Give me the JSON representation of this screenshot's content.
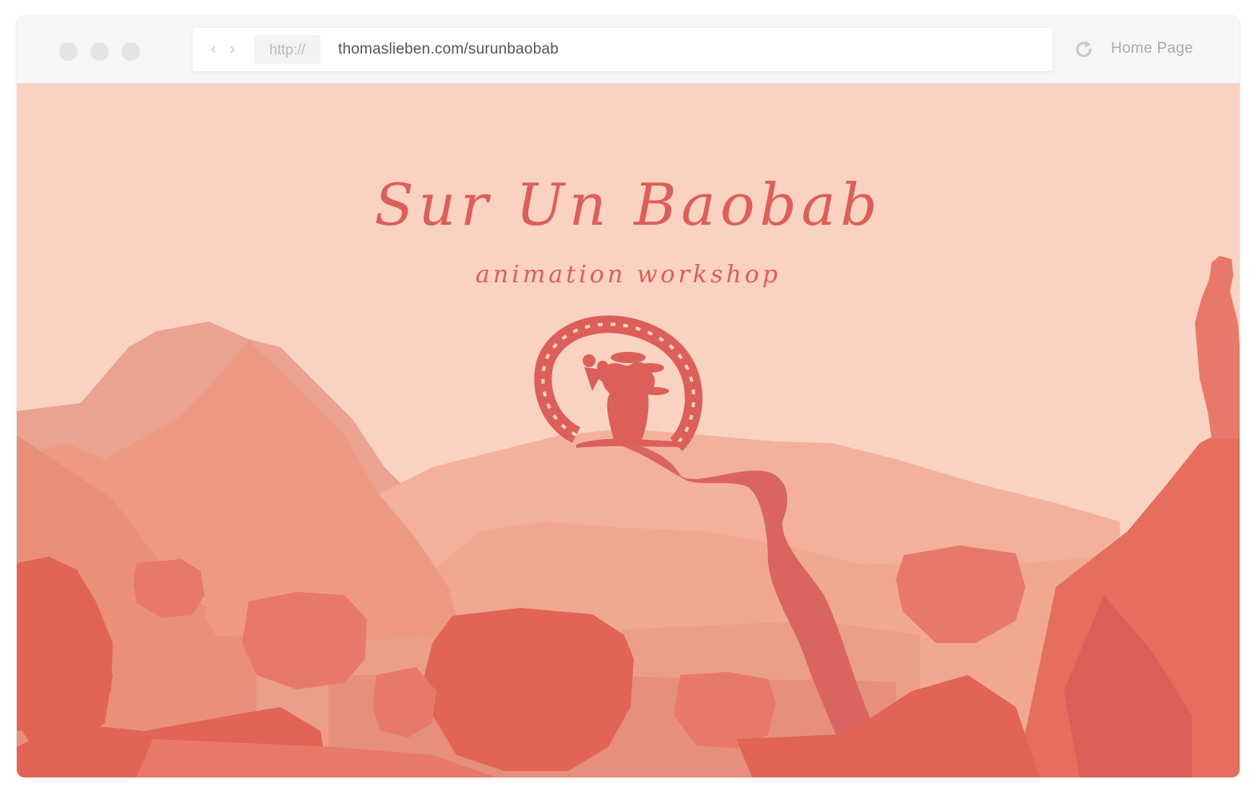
{
  "browser": {
    "protocol": "http://",
    "url": "thomaslieben.com/surunbaobab",
    "home_label": "Home Page",
    "icons": [
      "window-close-dot",
      "window-minimize-dot",
      "window-maximize-dot",
      "back-arrow-icon",
      "forward-arrow-icon",
      "reload-icon"
    ]
  },
  "page": {
    "title": "Sur Un Baobab",
    "subtitle": "animation workshop",
    "logo": "baobab-tree-logo",
    "colors": {
      "sky": "#fad2c2",
      "accent": "#dc5f59",
      "far_hills": "#f3ae98",
      "mid_hills": "#ee9a82",
      "trees": "#e8796a",
      "near_trees": "#e26456"
    }
  }
}
